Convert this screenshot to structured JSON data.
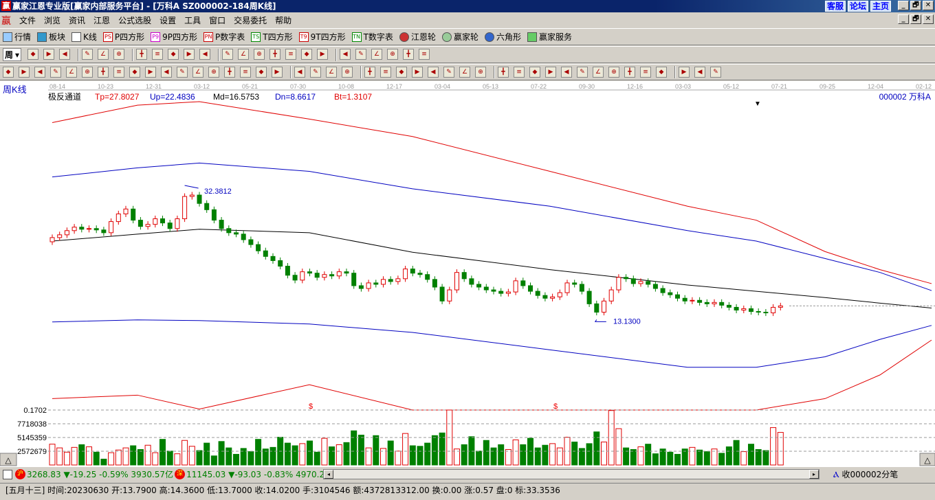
{
  "window": {
    "title": "赢家江恩专业版[赢家内部服务平台] - [万科A   SZ000002-184周K线]",
    "logo": "赢",
    "links": [
      "客服",
      "论坛",
      "主页"
    ],
    "controls": [
      "_",
      "🗗",
      "✕"
    ]
  },
  "menu": {
    "logo": "赢",
    "items": [
      "文件",
      "浏览",
      "资讯",
      "江恩",
      "公式选股",
      "设置",
      "工具",
      "窗口",
      "交易委托",
      "帮助"
    ]
  },
  "toolbar1": [
    {
      "icon": "grid",
      "label": "行情"
    },
    {
      "icon": "blocks",
      "label": "板块"
    },
    {
      "icon": "candles",
      "label": "K线"
    },
    {
      "icon": "PS",
      "label": "P四方形"
    },
    {
      "icon": "P9",
      "label": "9P四方形"
    },
    {
      "icon": "PN",
      "label": "P数字表"
    },
    {
      "icon": "TS",
      "label": "T四方形"
    },
    {
      "icon": "T9",
      "label": "9T四方形"
    },
    {
      "icon": "TN",
      "label": "T数字表"
    },
    {
      "icon": "wheel",
      "label": "江恩轮"
    },
    {
      "icon": "big-wheel",
      "label": "赢家轮"
    },
    {
      "icon": "hexagon",
      "label": "六角形"
    },
    {
      "icon": "dollar",
      "label": "赢家服务"
    }
  ],
  "toolbar2": {
    "period": "周"
  },
  "chart": {
    "period_label": "周K线",
    "dates": [
      "08-14",
      "10-23",
      "12-31",
      "03-12",
      "05-21",
      "07-30",
      "10-08",
      "12-17",
      "03-04",
      "05-13",
      "07-22",
      "09-30",
      "12-16",
      "03-03",
      "05-12",
      "07-21",
      "09-25",
      "12-04",
      "02-12"
    ],
    "indicator": {
      "name": "极反通道",
      "tp": "Tp=27.8027",
      "up": "Up=22.4836",
      "md": "Md=16.5753",
      "dn": "Dn=8.6617",
      "bt": "Bt=1.3107"
    },
    "stock": "000002  万科A",
    "high_label": "32.3812",
    "low_label": "13.1300",
    "lower_axis_label": "0.1702",
    "vol_ticks": [
      "7718038",
      "5145359",
      "2572679"
    ],
    "markers": [
      "$",
      "$"
    ],
    "colors": {
      "up": "#e00000",
      "down": "#008000",
      "tp": "#e00000",
      "up_line": "#0000c0",
      "md": "#000000",
      "dn": "#0000c0",
      "bt": "#e00000"
    }
  },
  "chart_data": {
    "type": "candlestick",
    "closes": [
      24.9,
      25.3,
      25.9,
      26.4,
      26.1,
      26.2,
      26.0,
      25.6,
      27.2,
      28.3,
      29.0,
      27.4,
      26.5,
      26.8,
      27.6,
      27.0,
      26.2,
      27.6,
      30.8,
      31.0,
      29.8,
      28.9,
      27.4,
      26.2,
      25.6,
      25.4,
      24.6,
      23.9,
      23.0,
      22.2,
      21.6,
      20.8,
      19.5,
      18.8,
      20.0,
      19.8,
      19.2,
      19.6,
      19.4,
      20.0,
      19.8,
      18.0,
      17.6,
      18.4,
      18.2,
      18.9,
      18.6,
      19.0,
      20.4,
      19.8,
      19.6,
      18.9,
      17.8,
      15.8,
      17.4,
      19.9,
      19.0,
      18.2,
      17.8,
      17.4,
      17.2,
      16.9,
      17.1,
      18.7,
      18.0,
      17.2,
      16.6,
      16.2,
      16.4,
      17.0,
      18.4,
      18.2,
      17.2,
      15.4,
      14.2,
      15.8,
      17.4,
      19.2,
      19.0,
      18.3,
      18.6,
      18.2,
      17.6,
      17.0,
      16.7,
      16.2,
      15.8,
      15.9,
      15.6,
      15.4,
      15.6,
      15.2,
      14.9,
      14.5,
      14.7,
      14.3,
      14.2,
      14.1,
      14.9,
      15.1
    ],
    "first_open": 24.3,
    "volume_millions": [
      3.9,
      3.2,
      2.4,
      3.3,
      3.8,
      3.4,
      2.4,
      1.1,
      2.3,
      2.8,
      3.2,
      3.6,
      2.9,
      3.7,
      2.3,
      4.8,
      2.6,
      2.1,
      4.6,
      3.5,
      2.7,
      4.1,
      1.7,
      4.4,
      3.2,
      2.0,
      3.1,
      2.5,
      4.8,
      3.0,
      3.3,
      5.2,
      4.1,
      3.6,
      4.0,
      4.5,
      2.4,
      5.0,
      3.4,
      3.8,
      4.2,
      6.4,
      5.6,
      3.2,
      5.5,
      3.1,
      4.5,
      2.6,
      5.9,
      3.6,
      3.5,
      4.1,
      5.5,
      6.0,
      10.5,
      3.0,
      3.8,
      5.3,
      2.6,
      4.6,
      3.2,
      3.8,
      2.9,
      4.7,
      3.8,
      5.0,
      3.2,
      3.7,
      4.0,
      3.2,
      5.2,
      4.3,
      3.1,
      4.0,
      6.2,
      4.3,
      10.2,
      6.8,
      3.2,
      2.9,
      3.4,
      3.9,
      2.1,
      3.0,
      2.4,
      2.0,
      3.0,
      3.3,
      2.8,
      2.5,
      3.0,
      2.2,
      3.4,
      4.6,
      2.5,
      3.9,
      2.9,
      2.7,
      7.0,
      6.1
    ],
    "channel": {
      "tp": [
        41.4,
        43.9,
        44.4,
        41.9,
        39.4,
        34.4,
        29.4,
        27.4,
        22.9,
        20.3,
        18.3
      ],
      "up": [
        33.6,
        34.9,
        35.6,
        34.4,
        31.9,
        29.4,
        25.9,
        24.4,
        21.9,
        19.9,
        17.3
      ],
      "md": [
        24.4,
        25.4,
        26.1,
        25.6,
        22.8,
        20.3,
        18.1,
        17.2,
        16.3,
        15.5,
        14.8
      ],
      "dn": [
        12.8,
        13.1,
        13.0,
        12.5,
        11.3,
        8.8,
        6.3,
        6.3,
        7.8,
        10.3,
        12.3
      ],
      "bt": [
        1.8,
        2.3,
        0.3,
        3.8,
        0.17,
        0.17,
        0.17,
        0.17,
        1.8,
        5.2,
        10.2
      ]
    },
    "high": 32.3812,
    "low": 13.13
  },
  "index_bar": {
    "sh_badge": "沪",
    "sh": "3268.83 ▼-19.25 -0.59% 3930.57亿",
    "sz_badge": "深",
    "sz": "11145.03 ▼-93.03 -0.83% 4970.2",
    "right": "收000002分笔"
  },
  "status": "[五月十三] 时间:20230630 开:13.7900 高:14.3600 低:13.7000 收:14.0200 手:3104546 额:4372813312.00 换:0.00 涨:0.57 盘:0 标:33.3536"
}
